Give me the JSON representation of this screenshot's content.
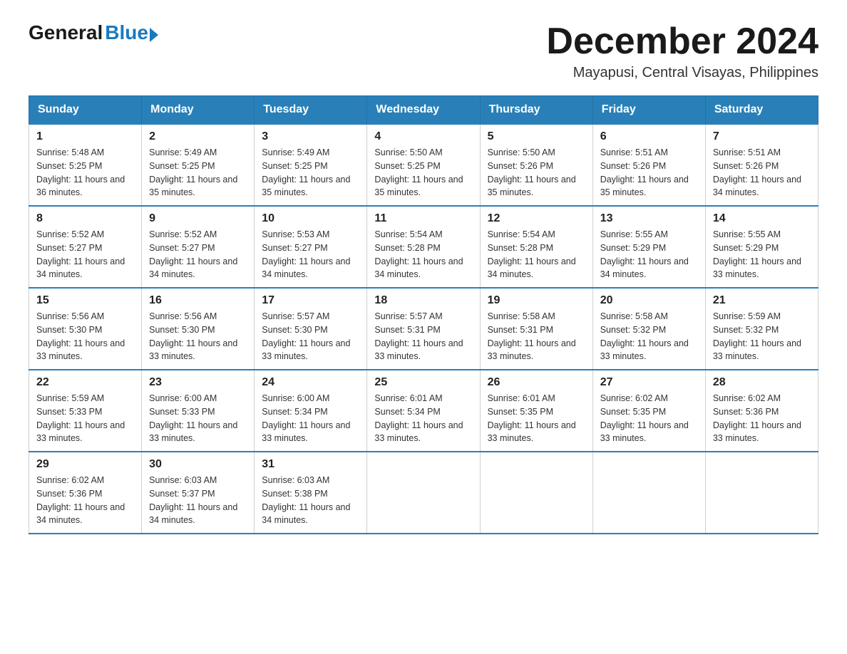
{
  "logo": {
    "general": "General",
    "blue": "Blue"
  },
  "title": "December 2024",
  "location": "Mayapusi, Central Visayas, Philippines",
  "days_of_week": [
    "Sunday",
    "Monday",
    "Tuesday",
    "Wednesday",
    "Thursday",
    "Friday",
    "Saturday"
  ],
  "weeks": [
    [
      {
        "day": "1",
        "sunrise": "5:48 AM",
        "sunset": "5:25 PM",
        "daylight": "11 hours and 36 minutes."
      },
      {
        "day": "2",
        "sunrise": "5:49 AM",
        "sunset": "5:25 PM",
        "daylight": "11 hours and 35 minutes."
      },
      {
        "day": "3",
        "sunrise": "5:49 AM",
        "sunset": "5:25 PM",
        "daylight": "11 hours and 35 minutes."
      },
      {
        "day": "4",
        "sunrise": "5:50 AM",
        "sunset": "5:25 PM",
        "daylight": "11 hours and 35 minutes."
      },
      {
        "day": "5",
        "sunrise": "5:50 AM",
        "sunset": "5:26 PM",
        "daylight": "11 hours and 35 minutes."
      },
      {
        "day": "6",
        "sunrise": "5:51 AM",
        "sunset": "5:26 PM",
        "daylight": "11 hours and 35 minutes."
      },
      {
        "day": "7",
        "sunrise": "5:51 AM",
        "sunset": "5:26 PM",
        "daylight": "11 hours and 34 minutes."
      }
    ],
    [
      {
        "day": "8",
        "sunrise": "5:52 AM",
        "sunset": "5:27 PM",
        "daylight": "11 hours and 34 minutes."
      },
      {
        "day": "9",
        "sunrise": "5:52 AM",
        "sunset": "5:27 PM",
        "daylight": "11 hours and 34 minutes."
      },
      {
        "day": "10",
        "sunrise": "5:53 AM",
        "sunset": "5:27 PM",
        "daylight": "11 hours and 34 minutes."
      },
      {
        "day": "11",
        "sunrise": "5:54 AM",
        "sunset": "5:28 PM",
        "daylight": "11 hours and 34 minutes."
      },
      {
        "day": "12",
        "sunrise": "5:54 AM",
        "sunset": "5:28 PM",
        "daylight": "11 hours and 34 minutes."
      },
      {
        "day": "13",
        "sunrise": "5:55 AM",
        "sunset": "5:29 PM",
        "daylight": "11 hours and 34 minutes."
      },
      {
        "day": "14",
        "sunrise": "5:55 AM",
        "sunset": "5:29 PM",
        "daylight": "11 hours and 33 minutes."
      }
    ],
    [
      {
        "day": "15",
        "sunrise": "5:56 AM",
        "sunset": "5:30 PM",
        "daylight": "11 hours and 33 minutes."
      },
      {
        "day": "16",
        "sunrise": "5:56 AM",
        "sunset": "5:30 PM",
        "daylight": "11 hours and 33 minutes."
      },
      {
        "day": "17",
        "sunrise": "5:57 AM",
        "sunset": "5:30 PM",
        "daylight": "11 hours and 33 minutes."
      },
      {
        "day": "18",
        "sunrise": "5:57 AM",
        "sunset": "5:31 PM",
        "daylight": "11 hours and 33 minutes."
      },
      {
        "day": "19",
        "sunrise": "5:58 AM",
        "sunset": "5:31 PM",
        "daylight": "11 hours and 33 minutes."
      },
      {
        "day": "20",
        "sunrise": "5:58 AM",
        "sunset": "5:32 PM",
        "daylight": "11 hours and 33 minutes."
      },
      {
        "day": "21",
        "sunrise": "5:59 AM",
        "sunset": "5:32 PM",
        "daylight": "11 hours and 33 minutes."
      }
    ],
    [
      {
        "day": "22",
        "sunrise": "5:59 AM",
        "sunset": "5:33 PM",
        "daylight": "11 hours and 33 minutes."
      },
      {
        "day": "23",
        "sunrise": "6:00 AM",
        "sunset": "5:33 PM",
        "daylight": "11 hours and 33 minutes."
      },
      {
        "day": "24",
        "sunrise": "6:00 AM",
        "sunset": "5:34 PM",
        "daylight": "11 hours and 33 minutes."
      },
      {
        "day": "25",
        "sunrise": "6:01 AM",
        "sunset": "5:34 PM",
        "daylight": "11 hours and 33 minutes."
      },
      {
        "day": "26",
        "sunrise": "6:01 AM",
        "sunset": "5:35 PM",
        "daylight": "11 hours and 33 minutes."
      },
      {
        "day": "27",
        "sunrise": "6:02 AM",
        "sunset": "5:35 PM",
        "daylight": "11 hours and 33 minutes."
      },
      {
        "day": "28",
        "sunrise": "6:02 AM",
        "sunset": "5:36 PM",
        "daylight": "11 hours and 33 minutes."
      }
    ],
    [
      {
        "day": "29",
        "sunrise": "6:02 AM",
        "sunset": "5:36 PM",
        "daylight": "11 hours and 34 minutes."
      },
      {
        "day": "30",
        "sunrise": "6:03 AM",
        "sunset": "5:37 PM",
        "daylight": "11 hours and 34 minutes."
      },
      {
        "day": "31",
        "sunrise": "6:03 AM",
        "sunset": "5:38 PM",
        "daylight": "11 hours and 34 minutes."
      },
      null,
      null,
      null,
      null
    ]
  ],
  "labels": {
    "sunrise": "Sunrise:",
    "sunset": "Sunset:",
    "daylight": "Daylight:"
  }
}
